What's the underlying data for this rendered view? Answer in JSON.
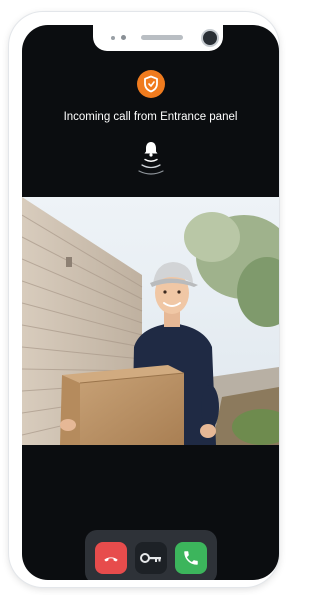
{
  "call": {
    "caller_text": "Incoming call from Entrance panel"
  },
  "icons": {
    "logo": "shield-logo-icon",
    "bell": "bell-ringing-icon",
    "decline": "phone-decline-icon",
    "key": "key-icon",
    "accept": "phone-accept-icon"
  },
  "colors": {
    "screen_bg": "#0b0d10",
    "logo_orange": "#f07b1e",
    "decline_red": "#e74c4c",
    "accept_green": "#3cb55c",
    "controls_bg": "#2e3238"
  }
}
